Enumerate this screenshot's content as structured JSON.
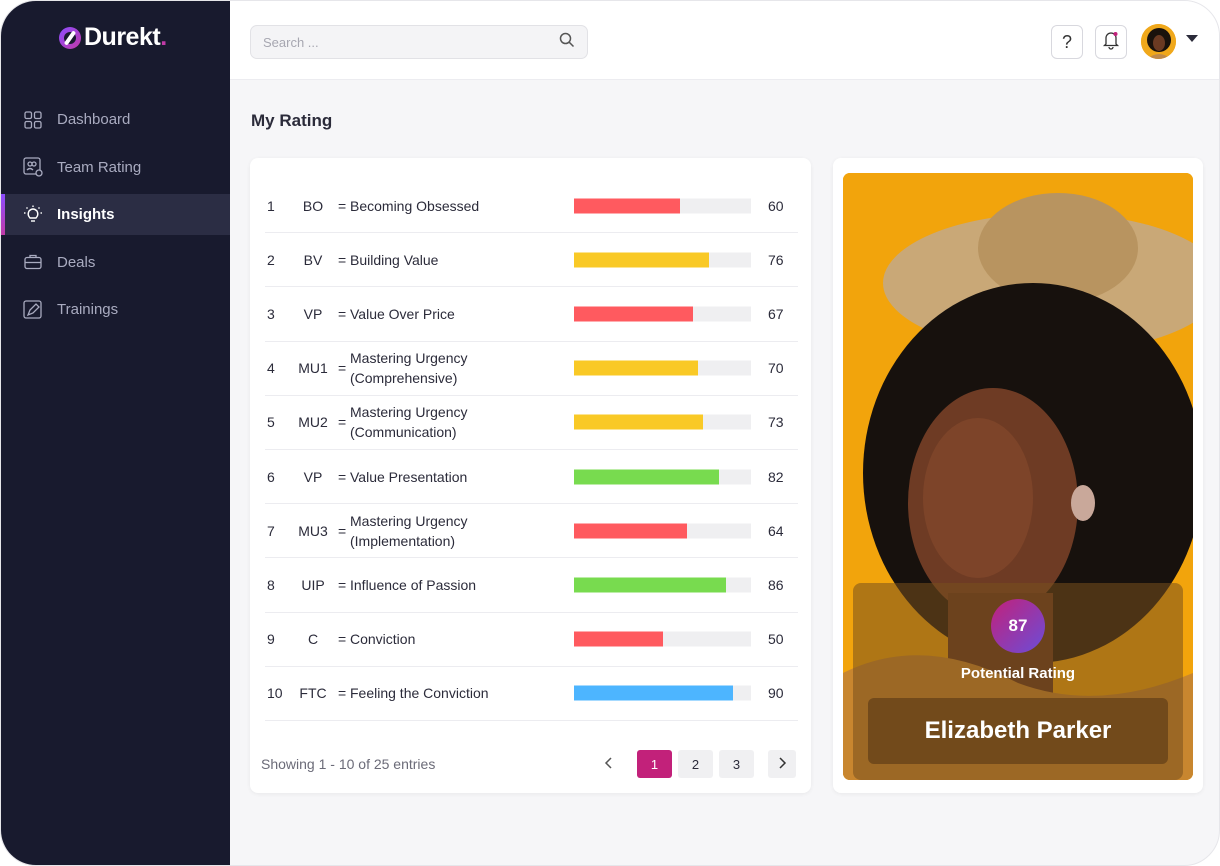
{
  "brand": {
    "name": "Durekt",
    "dot": "."
  },
  "nav": [
    {
      "label": "Dashboard",
      "icon": "grid-icon",
      "active": false
    },
    {
      "label": "Team Rating",
      "icon": "team-rating-icon",
      "active": false
    },
    {
      "label": "Insights",
      "icon": "lightbulb-icon",
      "active": true
    },
    {
      "label": "Deals",
      "icon": "briefcase-icon",
      "active": false
    },
    {
      "label": "Trainings",
      "icon": "pen-icon",
      "active": false
    }
  ],
  "search": {
    "placeholder": "Search ..."
  },
  "header": {
    "help": "?"
  },
  "page": {
    "title": "My Rating"
  },
  "ratings": [
    {
      "num": "1",
      "code": "BO",
      "label": "Becoming Obsessed",
      "value": 60,
      "color": "#ff5a5f"
    },
    {
      "num": "2",
      "code": "BV",
      "label": "Building Value",
      "value": 76,
      "color": "#f9c926"
    },
    {
      "num": "3",
      "code": "VP",
      "label": "Value Over Price",
      "value": 67,
      "color": "#ff5a5f"
    },
    {
      "num": "4",
      "code": "MU1",
      "label": "Mastering Urgency (Comprehensive)",
      "value": 70,
      "color": "#f9c926"
    },
    {
      "num": "5",
      "code": "MU2",
      "label": "Mastering Urgency (Communication)",
      "value": 73,
      "color": "#f9c926"
    },
    {
      "num": "6",
      "code": "VP",
      "label": "Value Presentation",
      "value": 82,
      "color": "#78db4f"
    },
    {
      "num": "7",
      "code": "MU3",
      "label": "Mastering Urgency (Implementation)",
      "value": 64,
      "color": "#ff5a5f"
    },
    {
      "num": "8",
      "code": "UIP",
      "label": "Influence of Passion",
      "value": 86,
      "color": "#78db4f"
    },
    {
      "num": "9",
      "code": "C",
      "label": "Conviction",
      "value": 50,
      "color": "#ff5a5f"
    },
    {
      "num": "10",
      "code": "FTC",
      "label": "Feeling the Conviction",
      "value": 90,
      "color": "#4db5ff"
    }
  ],
  "table_footer": {
    "showing": "Showing 1 - 10 of 25 entries"
  },
  "pagination": {
    "prev": "‹",
    "next": "›",
    "pages": [
      "1",
      "2",
      "3"
    ],
    "current": "1"
  },
  "profile": {
    "score": "87",
    "score_label": "Potential Rating",
    "name": "Elizabeth Parker"
  }
}
